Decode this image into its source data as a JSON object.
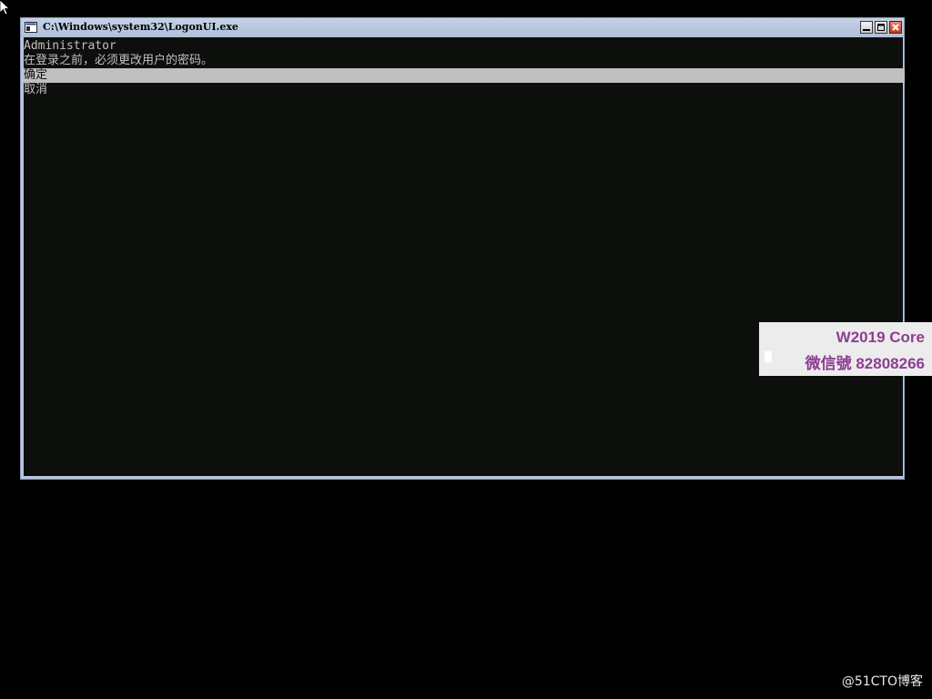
{
  "window": {
    "title": "C:\\Windows\\system32\\LogonUI.exe"
  },
  "console": {
    "lines": [
      "Administrator",
      "在登录之前，必须更改用户的密码。",
      "确定",
      "取消"
    ],
    "selected_index": 2
  },
  "overlay": {
    "line1": "W2019 Core",
    "line2": "微信號 82808266"
  },
  "watermark": {
    "text": "@51CTO博客"
  },
  "colors": {
    "console_background": "#0c0f0c",
    "console_text": "#c0c0c0",
    "highlight": "#c0c0c0",
    "titlebar": "#b9c6da",
    "overlay_text": "#8e3d93"
  },
  "icons": {
    "cursor": "mouse-pointer-icon",
    "title_icon": "console-window-icon",
    "minimize": "minimize-icon",
    "maximize": "maximize-icon",
    "close": "close-icon"
  }
}
